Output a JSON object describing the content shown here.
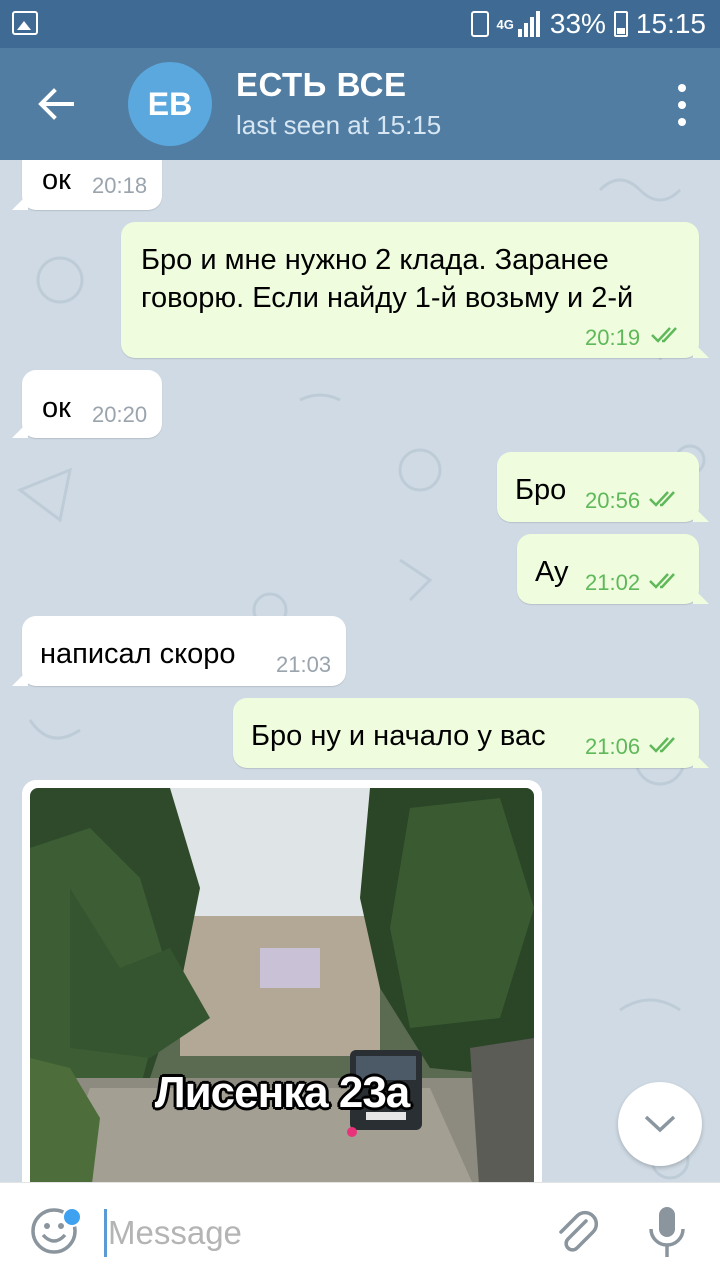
{
  "statusbar": {
    "network": "4G",
    "battery": "33%",
    "time": "15:15"
  },
  "header": {
    "avatar_initials": "EB",
    "title": "ЕСТЬ ВСЕ",
    "status": "last seen at 15:15"
  },
  "messages": [
    {
      "dir": "in",
      "text": "ок",
      "time": "20:18"
    },
    {
      "dir": "out",
      "lines": [
        "Бро и мне нужно 2 клада. Заранее",
        "говорю. Если найду 1-й возьму и 2-й"
      ],
      "time": "20:19",
      "read": true
    },
    {
      "dir": "in",
      "text": "ок",
      "time": "20:20"
    },
    {
      "dir": "out",
      "text": "Бро",
      "time": "20:56",
      "read": true
    },
    {
      "dir": "out",
      "text": "Ау",
      "time": "21:02",
      "read": true
    },
    {
      "dir": "in",
      "text": "написал скоро",
      "time": "21:03"
    },
    {
      "dir": "out",
      "text": "Бро ну и начало у вас",
      "time": "21:06",
      "read": true
    },
    {
      "dir": "in",
      "type": "photo",
      "caption": "Лисенка 23а"
    }
  ],
  "input": {
    "placeholder": "Message"
  },
  "colors": {
    "header": "#517da2",
    "statusbar": "#3e6a93",
    "chat_bg": "#cfdae4",
    "incoming": "#ffffff",
    "outgoing": "#effdde",
    "out_time": "#5fb85a"
  }
}
